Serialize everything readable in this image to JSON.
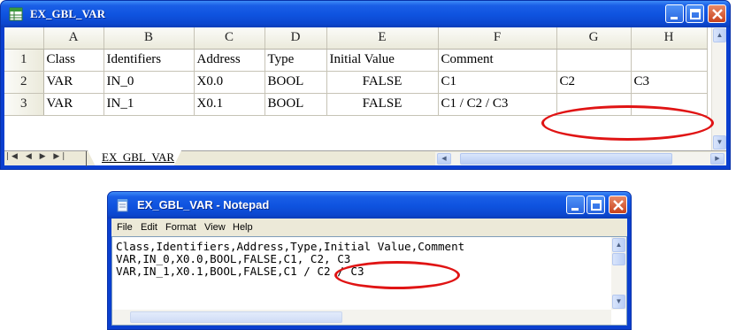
{
  "excel": {
    "title": "EX_GBL_VAR",
    "columns": [
      "A",
      "B",
      "C",
      "D",
      "E",
      "F",
      "G",
      "H"
    ],
    "rows": [
      {
        "num": "1",
        "cells": [
          "Class",
          "Identifiers",
          "Address",
          "Type",
          "Initial Value",
          "Comment",
          "",
          ""
        ]
      },
      {
        "num": "2",
        "cells": [
          "VAR",
          "IN_0",
          "X0.0",
          "BOOL",
          "FALSE",
          "C1",
          "C2",
          "C3"
        ]
      },
      {
        "num": "3",
        "cells": [
          "VAR",
          "IN_1",
          "X0.1",
          "BOOL",
          "FALSE",
          "C1 / C2 / C3",
          "",
          ""
        ]
      }
    ],
    "sheet_tab": "EX_GBL_VAR",
    "nav_arrows": "|◀ ◀ ▶ ▶|"
  },
  "notepad": {
    "title": "EX_GBL_VAR - Notepad",
    "menu": [
      "File",
      "Edit",
      "Format",
      "View",
      "Help"
    ],
    "lines": [
      "Class,Identifiers,Address,Type,Initial Value,Comment",
      "VAR,IN_0,X0.0,BOOL,FALSE,C1, C2, C3",
      "VAR,IN_1,X0.1,BOOL,FALSE,C1 / C2 / C3"
    ]
  },
  "colors": {
    "titlebar": "#0f54e0",
    "annotation": "#e01414",
    "close_button": "#c8431d"
  }
}
